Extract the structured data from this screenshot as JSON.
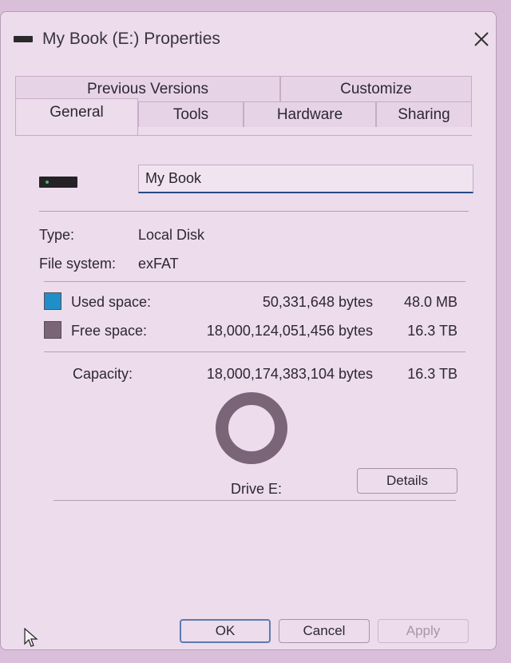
{
  "window": {
    "title": "My Book (E:) Properties"
  },
  "tabs": {
    "row1": [
      {
        "label": "Previous Versions"
      },
      {
        "label": "Customize"
      }
    ],
    "row2": [
      {
        "label": "General",
        "active": true
      },
      {
        "label": "Tools"
      },
      {
        "label": "Hardware"
      },
      {
        "label": "Sharing"
      }
    ]
  },
  "general": {
    "volume_name": "My Book",
    "type_label": "Type:",
    "type_value": "Local Disk",
    "fs_label": "File system:",
    "fs_value": "exFAT",
    "used_label": "Used space:",
    "used_bytes": "50,331,648 bytes",
    "used_human": "48.0 MB",
    "free_label": "Free space:",
    "free_bytes": "18,000,124,051,456 bytes",
    "free_human": "16.3 TB",
    "capacity_label": "Capacity:",
    "capacity_bytes": "18,000,174,383,104 bytes",
    "capacity_human": "16.3 TB",
    "drive_label": "Drive E:",
    "details_label": "Details",
    "used_fraction": 2.8e-06
  },
  "colors": {
    "used": "#1e8fc8",
    "free": "#7a6578",
    "accent": "#274a86"
  },
  "footer": {
    "ok": "OK",
    "cancel": "Cancel",
    "apply": "Apply"
  },
  "icons": {
    "title": "drive-icon",
    "close": "close-icon",
    "drive": "drive-icon",
    "cursor": "mouse-pointer-icon"
  }
}
